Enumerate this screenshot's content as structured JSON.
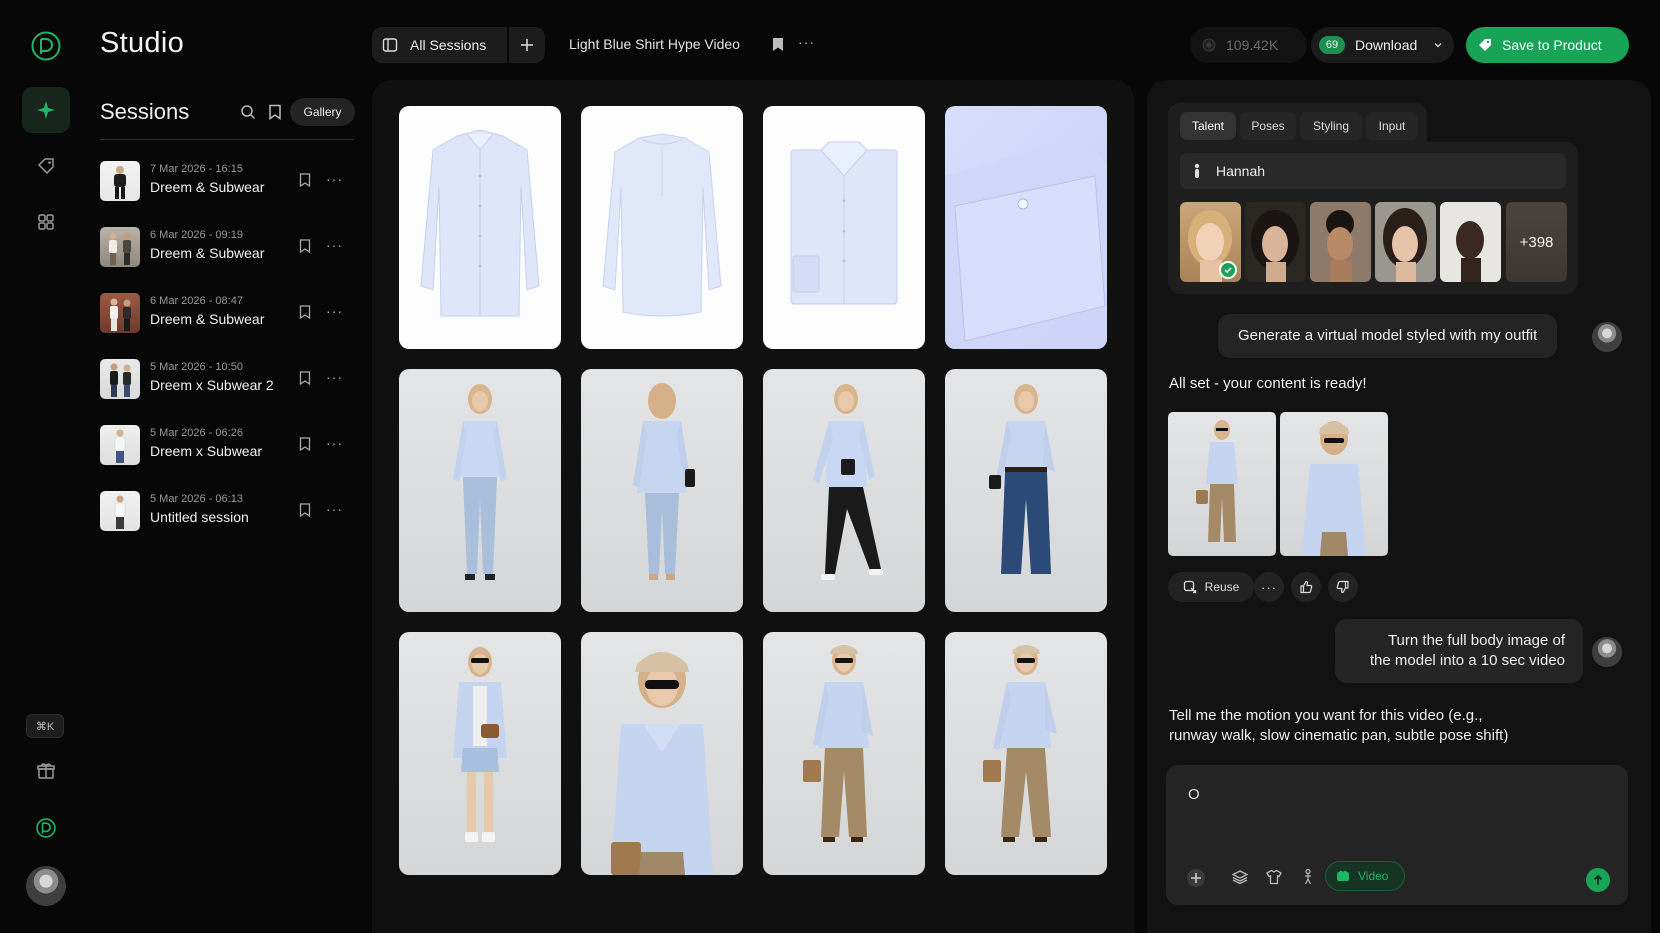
{
  "app": {
    "title": "Studio",
    "shortcut": "⌘K",
    "brand_color": "#17a457"
  },
  "sessions_panel": {
    "title": "Sessions",
    "gallery_label": "Gallery",
    "items": [
      {
        "date": "7 Mar 2026 - 16:15",
        "name": "Dreem & Subwear"
      },
      {
        "date": "6 Mar 2026 - 09:19",
        "name": "Dreem & Subwear"
      },
      {
        "date": "6 Mar 2026 - 08:47",
        "name": "Dreem & Subwear"
      },
      {
        "date": "5 Mar 2026 - 10:50",
        "name": "Dreem x Subwear 2"
      },
      {
        "date": "5 Mar 2026 - 06:26",
        "name": "Dreem x Subwear"
      },
      {
        "date": "5 Mar 2026 - 06:13",
        "name": "Untitled session"
      }
    ]
  },
  "topbar": {
    "all_sessions_label": "All Sessions",
    "session_title": "Light Blue Shirt Hype Video",
    "credits": "109.42K",
    "download_count": "69",
    "download_label": "Download",
    "save_label": "Save to Product"
  },
  "chat": {
    "tabs": [
      "Talent",
      "Poses",
      "Styling",
      "Input"
    ],
    "talent_name": "Hannah",
    "more_talent": "+398",
    "messages": {
      "user_1": "Generate a virtual model styled with my outfit",
      "ai_1": "All set - your content is ready!",
      "user_2_line1": "Turn the full body image of",
      "user_2_line2": "the model into a 10 sec video",
      "ai_2_line1": "Tell me the motion you want for this video (e.g.,",
      "ai_2_line2": "runway walk, slow cinematic pan, subtle pose shift)"
    },
    "reuse_label": "Reuse",
    "composer_value": "O",
    "video_chip_label": "Video"
  }
}
